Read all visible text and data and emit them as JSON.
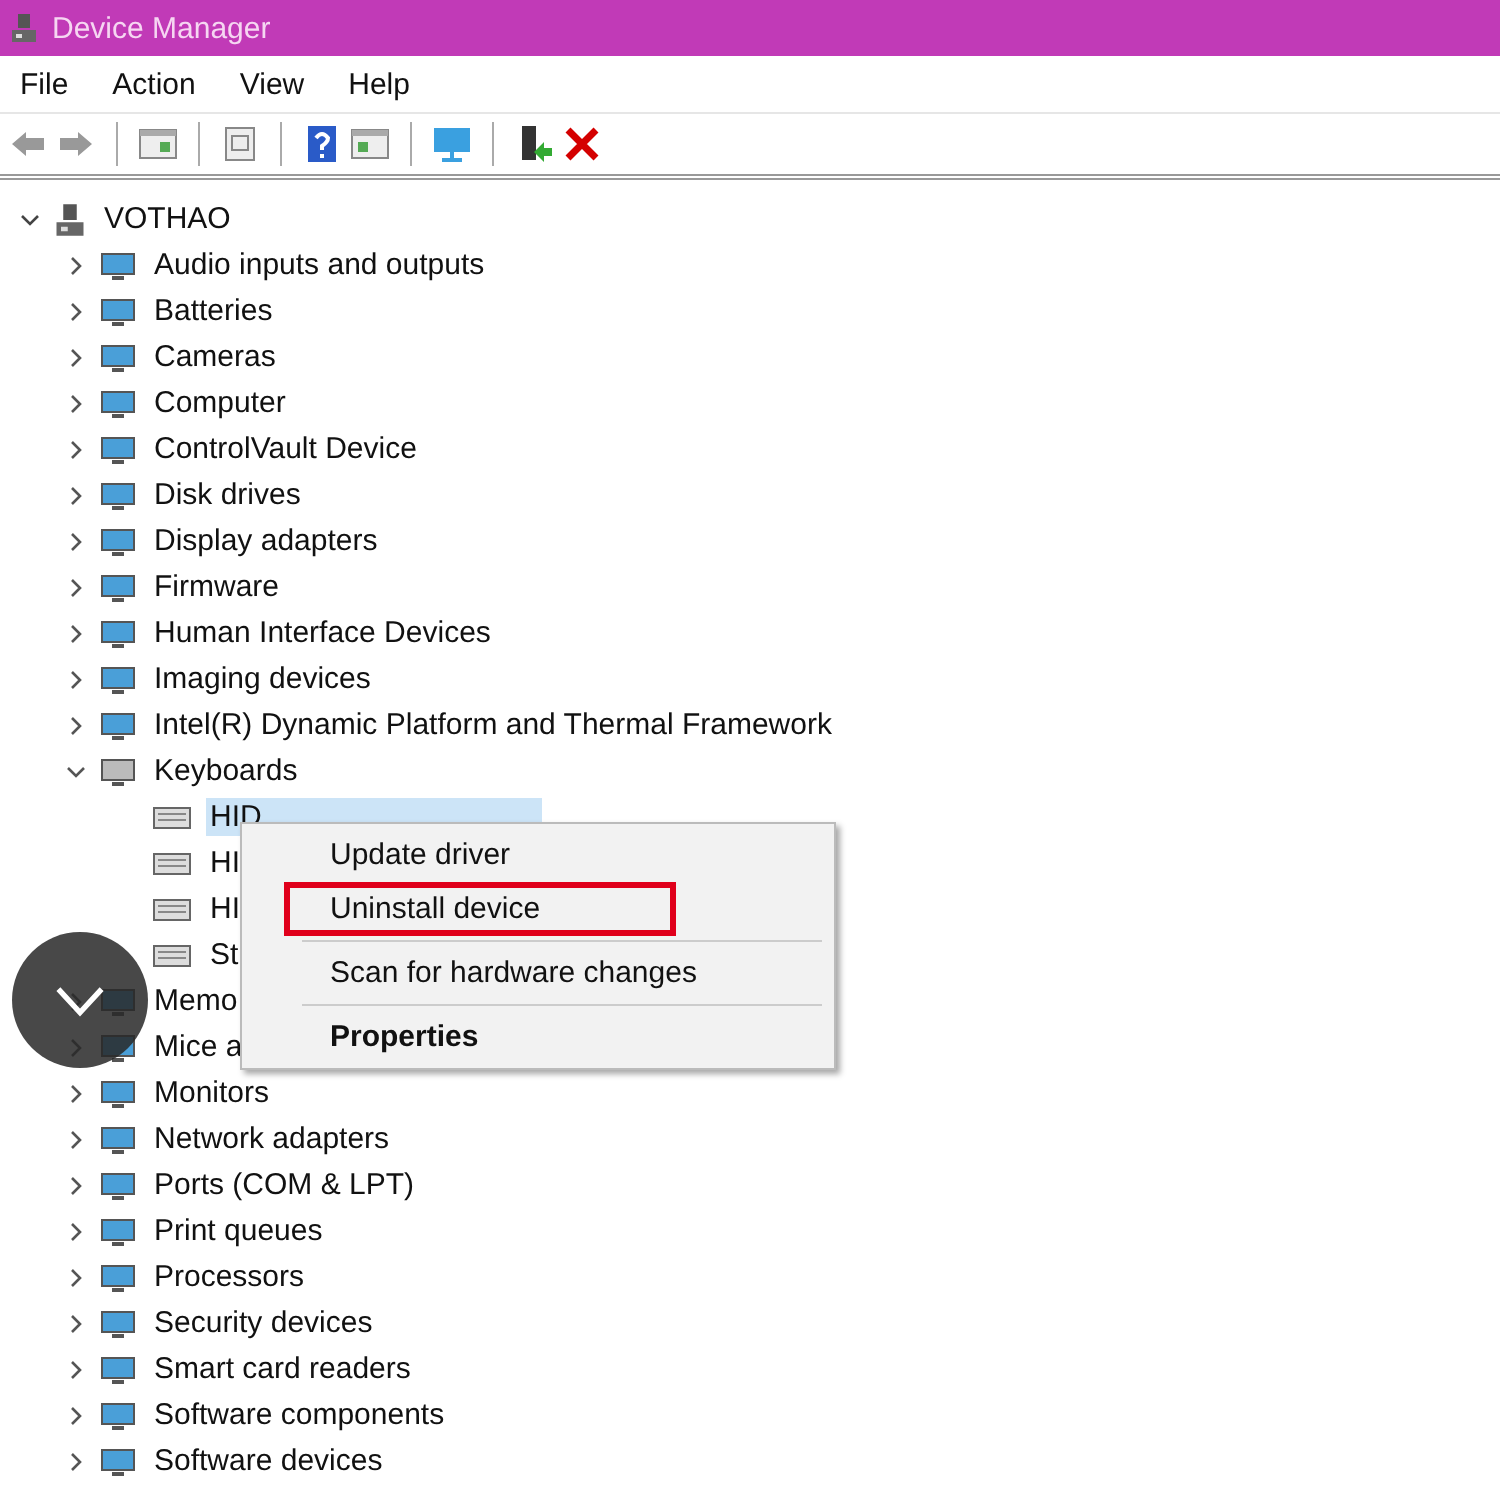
{
  "window": {
    "title": "Device Manager"
  },
  "menu_bar": [
    "File",
    "Action",
    "View",
    "Help"
  ],
  "tree": {
    "label": "VOTHAO",
    "expanded": true,
    "children": [
      {
        "label": "Audio inputs and outputs",
        "expanded": false
      },
      {
        "label": "Batteries",
        "expanded": false
      },
      {
        "label": "Cameras",
        "expanded": false
      },
      {
        "label": "Computer",
        "expanded": false
      },
      {
        "label": "ControlVault Device",
        "expanded": false
      },
      {
        "label": "Disk drives",
        "expanded": false
      },
      {
        "label": "Display adapters",
        "expanded": false
      },
      {
        "label": "Firmware",
        "expanded": false
      },
      {
        "label": "Human Interface Devices",
        "expanded": false
      },
      {
        "label": "Imaging devices",
        "expanded": false
      },
      {
        "label": "Intel(R) Dynamic Platform and Thermal Framework",
        "expanded": false
      },
      {
        "label": "Keyboards",
        "expanded": true,
        "children": [
          {
            "label": "HID",
            "selected": true
          },
          {
            "label": "HI",
            "selected": false
          },
          {
            "label": "HI",
            "selected": false
          },
          {
            "label": "St",
            "selected": false
          }
        ]
      },
      {
        "label": "Memo",
        "expanded": false
      },
      {
        "label": "Mice a",
        "expanded": false
      },
      {
        "label": "Monitors",
        "expanded": false
      },
      {
        "label": "Network adapters",
        "expanded": false
      },
      {
        "label": "Ports (COM & LPT)",
        "expanded": false
      },
      {
        "label": "Print queues",
        "expanded": false
      },
      {
        "label": "Processors",
        "expanded": false
      },
      {
        "label": "Security devices",
        "expanded": false
      },
      {
        "label": "Smart card readers",
        "expanded": false
      },
      {
        "label": "Software components",
        "expanded": false
      },
      {
        "label": "Software devices",
        "expanded": false
      }
    ]
  },
  "context_menu": [
    {
      "kind": "item",
      "label": "Update driver",
      "default": false,
      "highlighted": false
    },
    {
      "kind": "item",
      "label": "Uninstall device",
      "default": false,
      "highlighted": true
    },
    {
      "kind": "separator"
    },
    {
      "kind": "item",
      "label": "Scan for hardware changes",
      "default": false,
      "highlighted": false
    },
    {
      "kind": "separator"
    },
    {
      "kind": "item",
      "label": "Properties",
      "default": true,
      "highlighted": false
    }
  ]
}
